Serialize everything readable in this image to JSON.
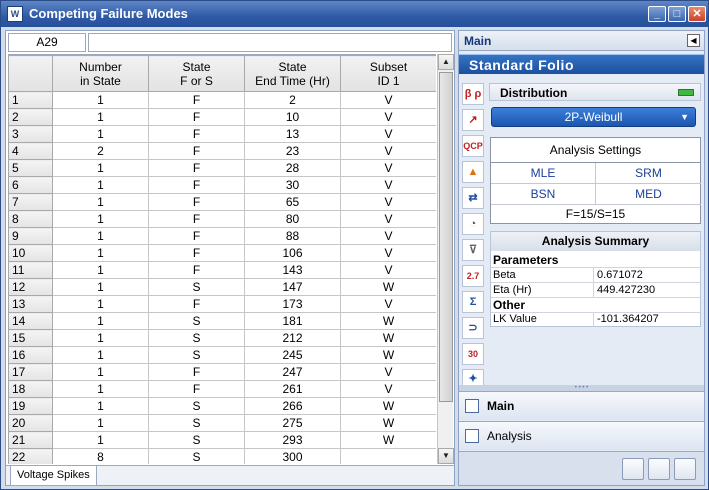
{
  "window": {
    "title": "Competing Failure Modes",
    "icon": "weibull-app-icon"
  },
  "cell_ref": "A29",
  "formula_bar": "",
  "grid": {
    "columns": [
      [
        "Number",
        "in State"
      ],
      [
        "State",
        "F or S"
      ],
      [
        "State",
        "End Time (Hr)"
      ],
      [
        "Subset",
        "ID 1"
      ]
    ],
    "rows": [
      {
        "n": "1",
        "num": "1",
        "state": "F",
        "time": "2",
        "id": "V"
      },
      {
        "n": "2",
        "num": "1",
        "state": "F",
        "time": "10",
        "id": "V"
      },
      {
        "n": "3",
        "num": "1",
        "state": "F",
        "time": "13",
        "id": "V"
      },
      {
        "n": "4",
        "num": "2",
        "state": "F",
        "time": "23",
        "id": "V"
      },
      {
        "n": "5",
        "num": "1",
        "state": "F",
        "time": "28",
        "id": "V"
      },
      {
        "n": "6",
        "num": "1",
        "state": "F",
        "time": "30",
        "id": "V"
      },
      {
        "n": "7",
        "num": "1",
        "state": "F",
        "time": "65",
        "id": "V"
      },
      {
        "n": "8",
        "num": "1",
        "state": "F",
        "time": "80",
        "id": "V"
      },
      {
        "n": "9",
        "num": "1",
        "state": "F",
        "time": "88",
        "id": "V"
      },
      {
        "n": "10",
        "num": "1",
        "state": "F",
        "time": "106",
        "id": "V"
      },
      {
        "n": "11",
        "num": "1",
        "state": "F",
        "time": "143",
        "id": "V"
      },
      {
        "n": "12",
        "num": "1",
        "state": "S",
        "time": "147",
        "id": "W"
      },
      {
        "n": "13",
        "num": "1",
        "state": "F",
        "time": "173",
        "id": "V"
      },
      {
        "n": "14",
        "num": "1",
        "state": "S",
        "time": "181",
        "id": "W"
      },
      {
        "n": "15",
        "num": "1",
        "state": "S",
        "time": "212",
        "id": "W"
      },
      {
        "n": "16",
        "num": "1",
        "state": "S",
        "time": "245",
        "id": "W"
      },
      {
        "n": "17",
        "num": "1",
        "state": "F",
        "time": "247",
        "id": "V"
      },
      {
        "n": "18",
        "num": "1",
        "state": "F",
        "time": "261",
        "id": "V"
      },
      {
        "n": "19",
        "num": "1",
        "state": "S",
        "time": "266",
        "id": "W"
      },
      {
        "n": "20",
        "num": "1",
        "state": "S",
        "time": "275",
        "id": "W"
      },
      {
        "n": "21",
        "num": "1",
        "state": "S",
        "time": "293",
        "id": "W"
      },
      {
        "n": "22",
        "num": "8",
        "state": "S",
        "time": "300",
        "id": ""
      }
    ]
  },
  "sheet_tab": "Voltage Spikes",
  "panel": {
    "header": "Main",
    "banner": "Standard Folio",
    "distribution": {
      "label": "Distribution",
      "selected": "2P-Weibull"
    },
    "settings": {
      "title": "Analysis Settings",
      "mle": "MLE",
      "srm": "SRM",
      "bsn": "BSN",
      "med": "MED",
      "fs": "F=15/S=15"
    },
    "summary": {
      "title": "Analysis Summary",
      "params_label": "Parameters",
      "beta_label": "Beta",
      "beta_value": "0.671072",
      "eta_label": "Eta (Hr)",
      "eta_value": "449.427230",
      "other_label": "Other",
      "lk_label": "LK Value",
      "lk_value": "-101.364207"
    },
    "tools": [
      "beta-rho-icon",
      "plot-line-icon",
      "qcp-icon",
      "warning-icon",
      "transfer-icon",
      "gauge-icon",
      "filter-icon",
      "calculator-icon",
      "sigma-icon",
      "magnet-icon",
      "report-icon",
      "probability-icon"
    ],
    "tool_text": {
      "t0": "β ρ",
      "t1": "↗",
      "t2": "QCP",
      "t3": "▲",
      "t4": "⇄",
      "t5": "◔",
      "t6": "⊽",
      "t7": "2.7",
      "t8": "Σ",
      "t9": "⊃",
      "t10": "30",
      "t11": "✦"
    },
    "nav_main": "Main",
    "nav_analysis": "Analysis"
  },
  "colors": {
    "accent": "#1b56b0",
    "title_bar": "#2f5aa6",
    "indicator": "#3fb83f"
  }
}
